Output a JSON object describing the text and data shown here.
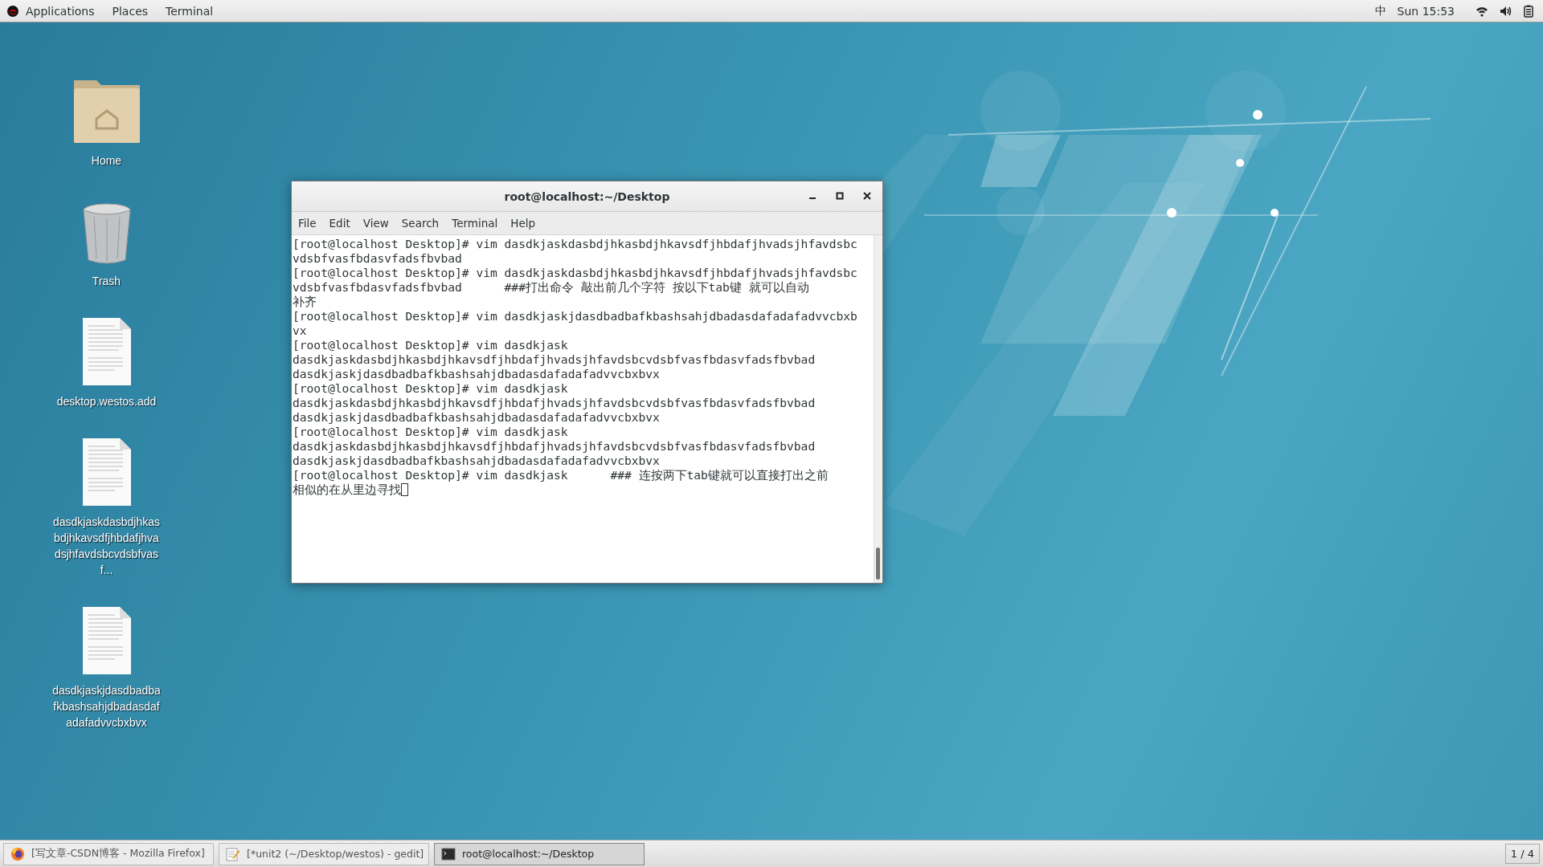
{
  "top_bar": {
    "menus": [
      "Applications",
      "Places",
      "Terminal"
    ],
    "input_method": "中",
    "clock": "Sun 15:53"
  },
  "desktop_icons": [
    {
      "kind": "folder",
      "label": "Home"
    },
    {
      "kind": "trash",
      "label": "Trash"
    },
    {
      "kind": "document",
      "label": "desktop.westos.add"
    },
    {
      "kind": "document",
      "label": "dasdkjaskdasbdjhkasbdjhkavsdfjhbdafjhvadsjhfavdsbcvdsbfvasf..."
    },
    {
      "kind": "document",
      "label": "dasdkjaskjdasdbadbafkbashsahjdbadasdafadafadvvcbxbvx"
    }
  ],
  "terminal_window": {
    "title": "root@localhost:~/Desktop",
    "menus": [
      "File",
      "Edit",
      "View",
      "Search",
      "Terminal",
      "Help"
    ],
    "lines": [
      "[root@localhost Desktop]# vim dasdkjaskdasbdjhkasbdjhkavsdfjhbdafjhvadsjhfavdsbc",
      "vdsbfvasfbdasvfadsfbvbad",
      "[root@localhost Desktop]# vim dasdkjaskdasbdjhkasbdjhkavsdfjhbdafjhvadsjhfavdsbc",
      "vdsbfvasfbdasvfadsfbvbad      ###打出命令 敲出前几个字符 按以下tab键 就可以自动",
      "补齐",
      "[root@localhost Desktop]# vim dasdkjaskjdasdbadbafkbashsahjdbadasdafadafadvvcbxb",
      "vx",
      "[root@localhost Desktop]# vim dasdkjask",
      "dasdkjaskdasbdjhkasbdjhkavsdfjhbdafjhvadsjhfavdsbcvdsbfvasfbdasvfadsfbvbad",
      "dasdkjaskjdasdbadbafkbashsahjdbadasdafadafadvvcbxbvx",
      "[root@localhost Desktop]# vim dasdkjask",
      "dasdkjaskdasbdjhkasbdjhkavsdfjhbdafjhvadsjhfavdsbcvdsbfvasfbdasvfadsfbvbad",
      "dasdkjaskjdasdbadbafkbashsahjdbadasdafadafadvvcbxbvx",
      "[root@localhost Desktop]# vim dasdkjask",
      "dasdkjaskdasbdjhkasbdjhkavsdfjhbdafjhvadsjhfavdsbcvdsbfvasfbdasvfadsfbvbad",
      "dasdkjaskjdasdbadbafkbashsahjdbadasdafadafadvvcbxbvx",
      "[root@localhost Desktop]# vim dasdkjask      ### 连按两下tab键就可以直接打出之前",
      "相似的在从里边寻找"
    ],
    "cursor": true
  },
  "taskbar": {
    "items": [
      {
        "kind": "browser",
        "label": "[写文章-CSDN博客 - Mozilla Firefox]",
        "selected": false
      },
      {
        "kind": "editor",
        "label": "[*unit2 (~/Desktop/westos) - gedit]",
        "selected": false
      },
      {
        "kind": "terminal",
        "label": "root@localhost:~/Desktop",
        "selected": true
      }
    ],
    "workspace": "1 / 4"
  }
}
